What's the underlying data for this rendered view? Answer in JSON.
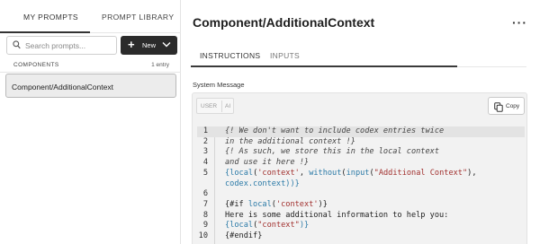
{
  "sidebar": {
    "tabs": [
      "MY PROMPTS",
      "PROMPT LIBRARY"
    ],
    "search_placeholder": "Search prompts...",
    "new_button": "New",
    "section_name": "COMPONENTS",
    "section_count": "1 entry",
    "items": [
      {
        "label": "Component/AdditionalContext",
        "selected": true
      }
    ]
  },
  "main": {
    "title": "Component/AdditionalContext",
    "more_label": "···",
    "tabs": [
      "INSTRUCTIONS",
      "INPUTS"
    ],
    "active_tab": "INSTRUCTIONS",
    "field_label": "System Message",
    "role_toggle": {
      "user": "USER",
      "ai": "AI"
    },
    "copy_label": "Copy",
    "code_lines": [
      {
        "n": "1",
        "highlighted": true,
        "segments": [
          {
            "t": "{! We don't want to include codex entries twice",
            "c": "cm"
          }
        ]
      },
      {
        "n": "2",
        "segments": [
          {
            "t": "in the additional context !}",
            "c": "cm"
          }
        ]
      },
      {
        "n": "3",
        "segments": [
          {
            "t": "{! As such, we store this in the local context",
            "c": "cm"
          }
        ]
      },
      {
        "n": "4",
        "segments": [
          {
            "t": "and use it here !}",
            "c": "cm"
          }
        ]
      },
      {
        "n": "5",
        "segments": [
          {
            "t": "{",
            "c": "br"
          },
          {
            "t": "local",
            "c": "kw"
          },
          {
            "t": "(",
            "c": "pl"
          },
          {
            "t": "'context'",
            "c": "st"
          },
          {
            "t": ", ",
            "c": "pl"
          },
          {
            "t": "without",
            "c": "kw"
          },
          {
            "t": "(",
            "c": "pl"
          },
          {
            "t": "input",
            "c": "kw"
          },
          {
            "t": "(",
            "c": "pl"
          },
          {
            "t": "\"Additional Context\"",
            "c": "st"
          },
          {
            "t": "),",
            "c": "pl"
          }
        ]
      },
      {
        "n": "",
        "segments": [
          {
            "t": "codex.context",
            "c": "kw"
          },
          {
            "t": "))}",
            "c": "br"
          }
        ]
      },
      {
        "n": "6",
        "segments": []
      },
      {
        "n": "7",
        "segments": [
          {
            "t": "{#if ",
            "c": "pl"
          },
          {
            "t": "local",
            "c": "kw"
          },
          {
            "t": "(",
            "c": "pl"
          },
          {
            "t": "'context'",
            "c": "st"
          },
          {
            "t": ")}",
            "c": "pl"
          }
        ]
      },
      {
        "n": "8",
        "segments": [
          {
            "t": "Here is some additional information to help you:",
            "c": "pl"
          }
        ]
      },
      {
        "n": "9",
        "segments": [
          {
            "t": "{",
            "c": "br"
          },
          {
            "t": "local",
            "c": "kw"
          },
          {
            "t": "(",
            "c": "pl"
          },
          {
            "t": "\"context\"",
            "c": "st"
          },
          {
            "t": ")}",
            "c": "br"
          }
        ]
      },
      {
        "n": "10",
        "segments": [
          {
            "t": "{#endif}",
            "c": "pl"
          }
        ]
      }
    ]
  }
}
